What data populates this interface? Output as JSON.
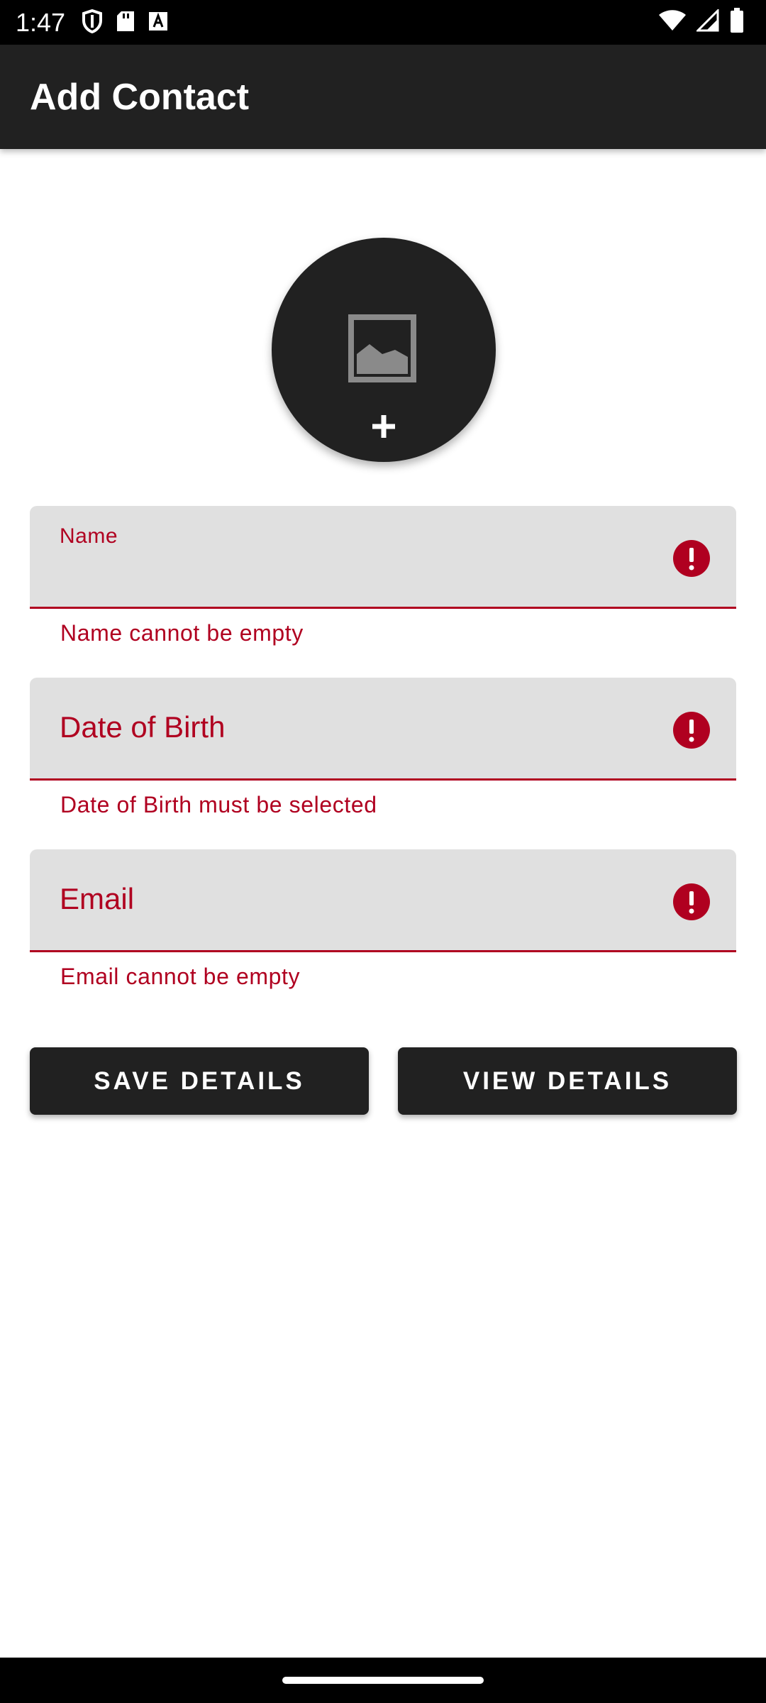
{
  "status_bar": {
    "time": "1:47",
    "left_icons": [
      "shield-icon",
      "sd-card-icon",
      "font-icon"
    ],
    "right_icons": [
      "wifi-icon",
      "cell-signal-icon",
      "battery-icon"
    ]
  },
  "app_bar": {
    "title": "Add Contact"
  },
  "avatar": {
    "icon": "image-icon",
    "action_icon": "plus-icon"
  },
  "form": {
    "name": {
      "label": "Name",
      "value": "",
      "error": "Name cannot be empty"
    },
    "dob": {
      "label": "Date of Birth",
      "value": "",
      "error": "Date of Birth must be selected"
    },
    "email": {
      "label": "Email",
      "value": "",
      "error": "Email cannot be empty"
    }
  },
  "buttons": {
    "save": "SAVE DETAILS",
    "view": "VIEW DETAILS"
  },
  "colors": {
    "app_bar": "#212121",
    "error": "#b00020",
    "field_bg": "#e0e0e0",
    "button_bg": "#212121"
  }
}
